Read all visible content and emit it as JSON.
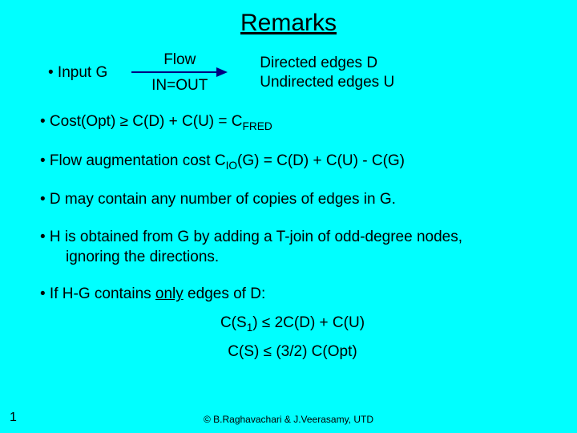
{
  "title": "Remarks",
  "inputG": "• Input G",
  "flow": "Flow",
  "inout": "IN=OUT",
  "edges1": "Directed edges D",
  "edges2": "Undirected edges U",
  "bullet1_pre": "• Cost(Opt) ",
  "bullet1_ge": "≥",
  "bullet1_mid": " C(D) + C(U) = C",
  "bullet1_sub": "FRED",
  "bullet2_pre": "• Flow augmentation cost C",
  "bullet2_sub": "IO",
  "bullet2_post": "(G) = C(D) + C(U) - C(G)",
  "bullet3": "• D may contain any number of copies of edges in G.",
  "bullet4a": "• H is obtained from G by adding a T-join of odd-degree nodes,",
  "bullet4b": "ignoring the directions.",
  "bullet5_pre": "• If  H-G contains ",
  "bullet5_only": "only",
  "bullet5_post": " edges of D:",
  "eq1_pre": "C(S",
  "eq1_sub": "1",
  "eq1_post": ") ≤ 2C(D) + C(U)",
  "eq2": "C(S) ≤ (3/2) C(Opt)",
  "pageNum": "1",
  "footer": "© B.Raghavachari & J.Veerasamy, UTD"
}
